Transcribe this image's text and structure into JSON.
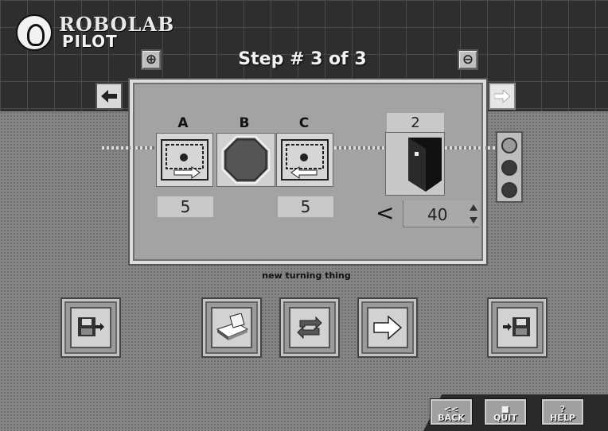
{
  "logo": {
    "line1": "ROBOLAB",
    "line2": "PILOT"
  },
  "header": {
    "title": "Step # 3 of 3",
    "zoom_in_label": "⊕",
    "zoom_out_label": "⊖"
  },
  "ports": {
    "a": "A",
    "b": "B",
    "c": "C"
  },
  "motor_a": {
    "power": "5"
  },
  "motor_c": {
    "power": "5"
  },
  "sensor": {
    "port": "2",
    "compare_symbol": "<",
    "threshold": "40"
  },
  "program_caption": "new turning thing",
  "nav": {
    "back": "BACK",
    "back_symbol": "<<",
    "quit": "QUIT",
    "quit_symbol": "■",
    "help": "HELP",
    "help_symbol": "?"
  },
  "colors": {
    "background": "#858585",
    "panel": "#a3a3a3",
    "top_band": "#2e2e2e"
  }
}
